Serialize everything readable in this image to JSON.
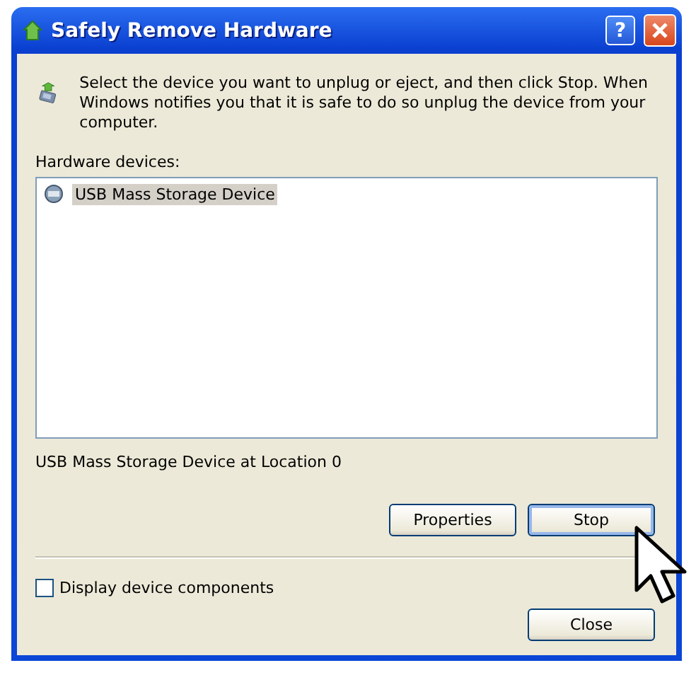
{
  "window": {
    "title": "Safely Remove Hardware",
    "help": "?"
  },
  "instructions": "Select the device you want to unplug or eject, and then click Stop. When Windows notifies you that it is safe to do so unplug the device from your computer.",
  "devices_label": "Hardware devices:",
  "devices": [
    {
      "name": "USB Mass Storage Device",
      "selected": true
    }
  ],
  "device_location": "USB Mass Storage Device at Location 0",
  "buttons": [
    "Properties",
    "Stop"
  ],
  "display_components": {
    "label": "Display device components",
    "checked": false
  },
  "close_button": "Close"
}
